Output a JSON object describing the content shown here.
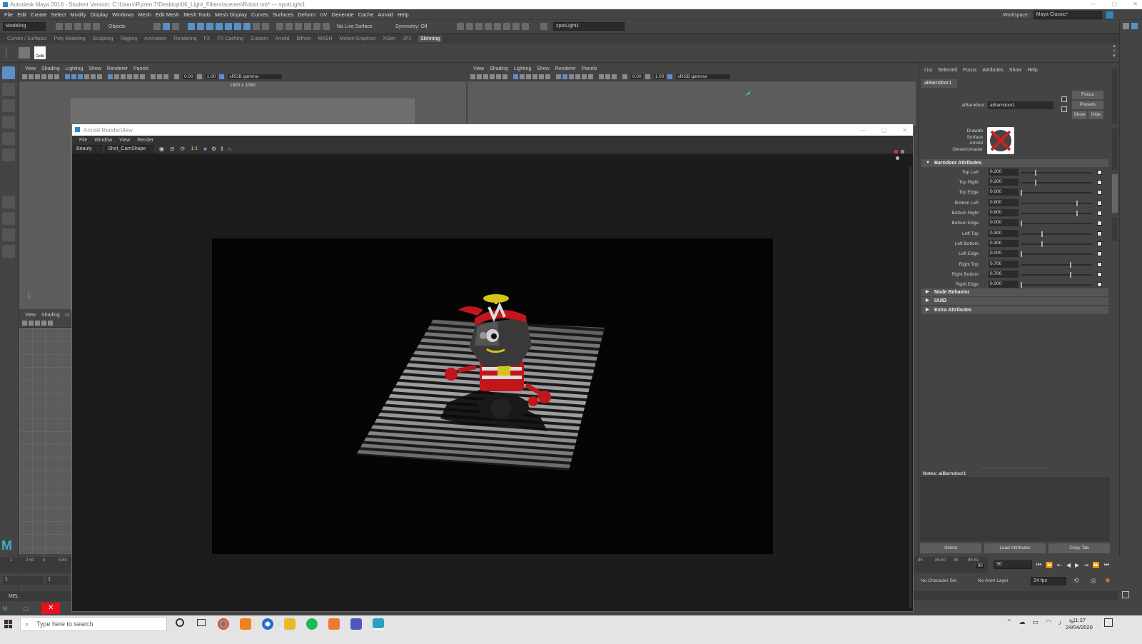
{
  "window": {
    "title": "Autodesk Maya 2018 - Student Version: C:\\Users\\Ryzen 7\\Desktop\\06_Light_Filters\\scenes\\Robot.mb* --- spotLight1"
  },
  "menubar": [
    "File",
    "Edit",
    "Create",
    "Select",
    "Modify",
    "Display",
    "Windows",
    "Mesh",
    "Edit Mesh",
    "Mesh Tools",
    "Mesh Display",
    "Curves",
    "Surfaces",
    "Deform",
    "UV",
    "Generate",
    "Cache",
    "Arnold",
    "Help"
  ],
  "workspace": {
    "label": "Workspace :",
    "value": "Maya Classic*"
  },
  "statusline": {
    "mode": "Modeling",
    "select_mode": "Objects",
    "live_surface": "No Live Surface",
    "symmetry": "Symmetry: Off",
    "search_value": "spotLight1"
  },
  "shelf_tabs": [
    "Curves / Surfaces",
    "Poly Modeling",
    "Sculpting",
    "Rigging",
    "Animation",
    "Rendering",
    "FX",
    "FX Caching",
    "Custom",
    "Arnold",
    "Bifrost",
    "MASH",
    "Motion Graphics",
    "XGen",
    "JPJ",
    "Skinning"
  ],
  "shelf_active_tab": "Skinning",
  "shelf_icon_label": "Cplld",
  "viewport_menu": [
    "View",
    "Shading",
    "Lighting",
    "Show",
    "Renderer",
    "Panels"
  ],
  "viewport_small_menu": [
    "View",
    "Shading",
    "Li"
  ],
  "viewport_toolbar": {
    "exposure": "0.00",
    "gamma": "1.00",
    "colorspace": "sRGB gamma"
  },
  "resolution_gate": "1920 x 1080",
  "renderview": {
    "title": "Arnold RenderView",
    "menu": [
      "File",
      "Window",
      "View",
      "Render"
    ],
    "aov": "Beauty",
    "camera": "Shot_CamShape",
    "zoom_label": "1:1"
  },
  "attribute_editor": {
    "menu": [
      "List",
      "Selected",
      "Focus",
      "Attributes",
      "Show",
      "Help"
    ],
    "node_tab": "aiBarndoor1",
    "node_label": "aiBarndoor:",
    "node_value": "aiBarndoor1",
    "buttons": {
      "focus": "Focus",
      "presets": "Presets",
      "show": "Show",
      "hide": "Hide"
    },
    "classification": [
      "Drawdb",
      "Surface",
      "Arnold",
      "Genericshader"
    ],
    "section_barndoor": "Barndoor Attributes",
    "attributes": [
      {
        "label": "Top Left",
        "value": "0.200",
        "slider": 0.2
      },
      {
        "label": "Top Right",
        "value": "0.200",
        "slider": 0.2
      },
      {
        "label": "Top Edge",
        "value": "0.000",
        "slider": 0.0
      },
      {
        "label": "Bottom Left",
        "value": "0.800",
        "slider": 0.8
      },
      {
        "label": "Bottom Right",
        "value": "0.800",
        "slider": 0.8
      },
      {
        "label": "Bottom Edge",
        "value": "0.000",
        "slider": 0.0
      },
      {
        "label": "Left Top",
        "value": "0.300",
        "slider": 0.3
      },
      {
        "label": "Left Bottom",
        "value": "0.300",
        "slider": 0.3
      },
      {
        "label": "Left Edge",
        "value": "0.000",
        "slider": 0.0
      },
      {
        "label": "Right Top",
        "value": "0.700",
        "slider": 0.7
      },
      {
        "label": "Right Bottom",
        "value": "0.700",
        "slider": 0.7
      },
      {
        "label": "Right Edge",
        "value": "0.000",
        "slider": 0.0
      }
    ],
    "collapsed_sections": [
      "Node Behavior",
      "UUID",
      "Extra Attributes"
    ],
    "notes": "Notes: aiBarndoor1",
    "bottom_buttons": [
      "Select",
      "Load Attributes",
      "Copy Tab"
    ]
  },
  "timeline": {
    "ticks_left": [
      "1",
      "2.50",
      "4",
      "5.50"
    ],
    "ticks_right": [
      "85",
      "86.50",
      "88",
      "89.50"
    ],
    "current_frame": "90",
    "range_end": "90",
    "start_frame": "1",
    "start_frame2": "1",
    "character_set": "No Character Set",
    "anim_layer": "No Anim Layer",
    "fps": "24 fps"
  },
  "command_line": {
    "label": "MEL"
  },
  "taskbar": {
    "search_placeholder": "Type here to search",
    "time": "11:27",
    "date": "24/04/2020"
  },
  "colors": {
    "maya_bg": "#444444",
    "accent_blue": "#5a8fc8",
    "render_bg": "#050505",
    "robot_red": "#c0161c",
    "helmet_yellow": "#d4c419"
  }
}
